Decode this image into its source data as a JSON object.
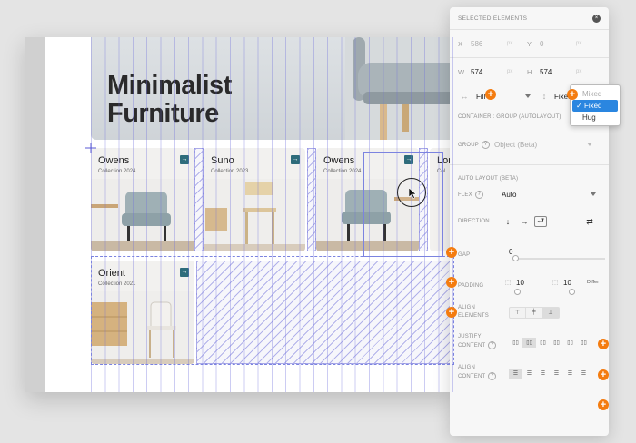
{
  "hero": {
    "title": "Minimalist\nFurniture"
  },
  "cards": [
    {
      "title": "Owens",
      "subtitle": "Collection 2024"
    },
    {
      "title": "Suno",
      "subtitle": "Collection 2023"
    },
    {
      "title": "Owens",
      "subtitle": "Collection 2024"
    },
    {
      "title": "Lon",
      "subtitle": "Col"
    },
    {
      "title": "Orient",
      "subtitle": "Collection 2021"
    }
  ],
  "card_arrow_glyph": "→",
  "panel": {
    "title": "SELECTED ELEMENTS",
    "close_glyph": "×",
    "x_label": "X",
    "x_value": "586",
    "x_unit": "px",
    "y_label": "Y",
    "y_value": "0",
    "y_unit": "px",
    "w_label": "W",
    "w_value": "574",
    "w_unit": "px",
    "h_label": "H",
    "h_value": "574",
    "h_unit": "px",
    "w_mode": "Fill",
    "h_mode": "Fixed",
    "container_label": "CONTAINER : GROUP (AUTOLAYOUT)",
    "group_label": "GROUP",
    "group_value": "Object (Beta)",
    "auto_layout_title": "AUTO LAYOUT (BETA)",
    "flex_label": "FLEX",
    "flex_value": "Auto",
    "direction_label": "DIRECTION",
    "gap_label": "GAP",
    "gap_value": "0",
    "padding_label": "PADDING",
    "padding_value_1": "10",
    "padding_value_2": "10",
    "padding_extra": "Differ",
    "align_elements_label": "ALIGN\nELEMENTS",
    "justify_content_label": "JUSTIFY\nCONTENT",
    "align_content_label": "ALIGN\nCONTENT"
  },
  "size_popup": {
    "options": [
      "Mixed",
      "Fixed",
      "Hug"
    ],
    "selected": "Fixed",
    "check": "✓"
  },
  "colors": {
    "accent_orange": "#f47c10",
    "selection_blue": "#7b83e0",
    "teal_arrow": "#2e6c7b",
    "popup_selected": "#2a86e0"
  }
}
